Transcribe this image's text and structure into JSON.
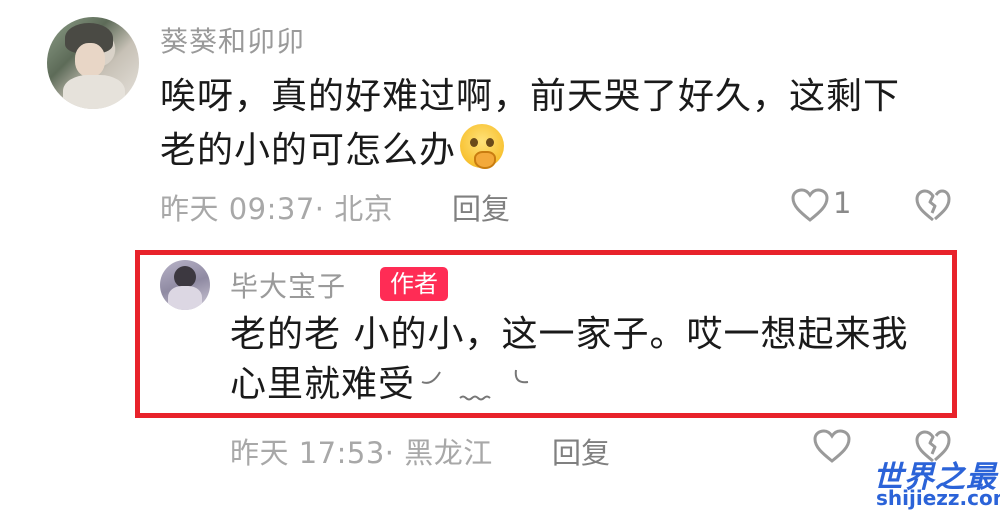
{
  "comment1": {
    "username": "葵葵和卯卯",
    "text_line1": "唉呀，真的好难过啊，前天哭了好久，这剩下",
    "text_line2": "老的小的可怎么办",
    "time_location": "昨天 09:37· 北京",
    "reply_label": "回复",
    "like_count": "1",
    "emoji_icon": "pleading-face-emoji"
  },
  "comment2": {
    "username": "毕大宝子",
    "badge": "作者",
    "text_line1": "老的老 小的小，这一家子。哎一想起来我",
    "text_line2": "心里就难受",
    "time_location": "昨天 17:53· 黑龙江",
    "reply_label": "回复",
    "highlight_color": "#e8222b"
  },
  "watermark": {
    "title": "世界之最",
    "url": "shijiezz.com",
    "color": "#2b63d8"
  }
}
